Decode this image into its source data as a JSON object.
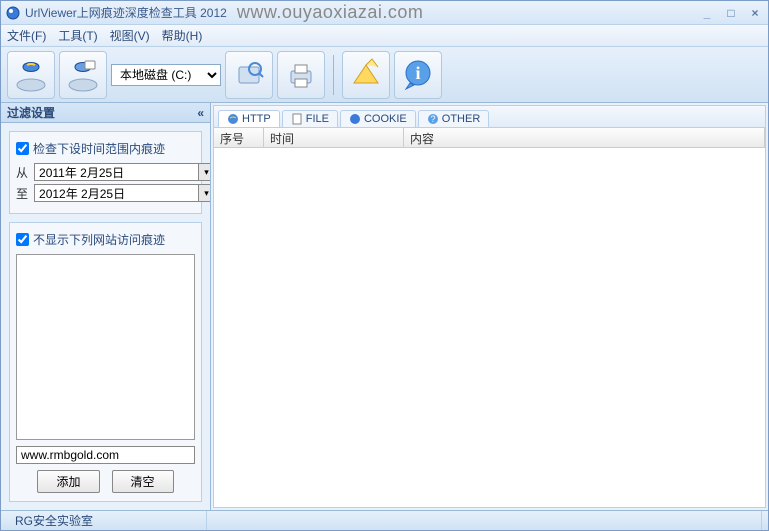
{
  "title": "UrlViewer上网痕迹深度检查工具 2012",
  "watermark": "www.ouyaoxiazai.com",
  "menu": {
    "file": "文件(F)",
    "tools": "工具(T)",
    "view": "视图(V)",
    "help": "帮助(H)"
  },
  "toolbar": {
    "drive_selected": "本地磁盘 (C:)"
  },
  "sidebar": {
    "header": "过滤设置",
    "toggle": "«",
    "time_filter_label": "检查下设时间范围内痕迹",
    "from_label": "从",
    "to_label": "至",
    "from_date": "2011年 2月25日",
    "to_date": "2012年 2月25日",
    "exclude_label": "不显示下列网站访问痕迹",
    "url_value": "www.rmbgold.com",
    "add_btn": "添加",
    "clear_btn": "清空"
  },
  "tabs": {
    "http": "HTTP",
    "file": "FILE",
    "cookie": "COOKIE",
    "other": "OTHER"
  },
  "columns": {
    "seq": "序号",
    "time": "时间",
    "content": "内容"
  },
  "status": {
    "lab": "RG安全实验室"
  }
}
